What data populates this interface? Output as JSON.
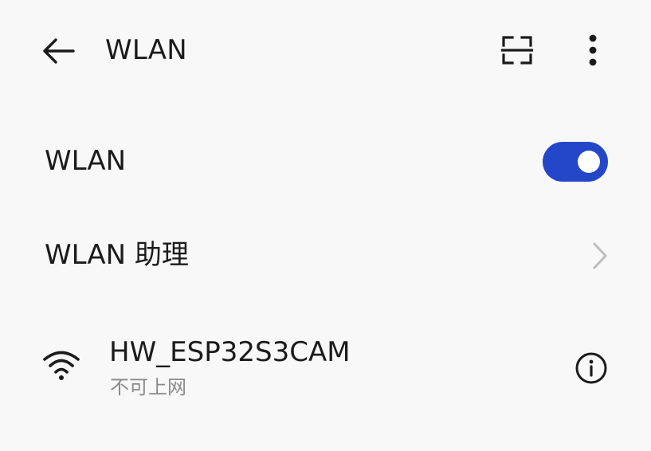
{
  "header": {
    "back_icon": "arrow-left-icon",
    "title": "WLAN",
    "scan_icon": "scan-frame-icon",
    "more_icon": "more-vertical-icon"
  },
  "settings": {
    "wlan_toggle": {
      "label": "WLAN",
      "enabled": true,
      "accent_color": "#2447c9"
    },
    "assistant": {
      "label": "WLAN 助理",
      "icon": "chevron-right-icon"
    }
  },
  "networks": [
    {
      "name": "HW_ESP32S3CAM",
      "status": "不可上网",
      "signal_icon": "wifi-signal-icon",
      "info_icon": "info-icon"
    }
  ]
}
